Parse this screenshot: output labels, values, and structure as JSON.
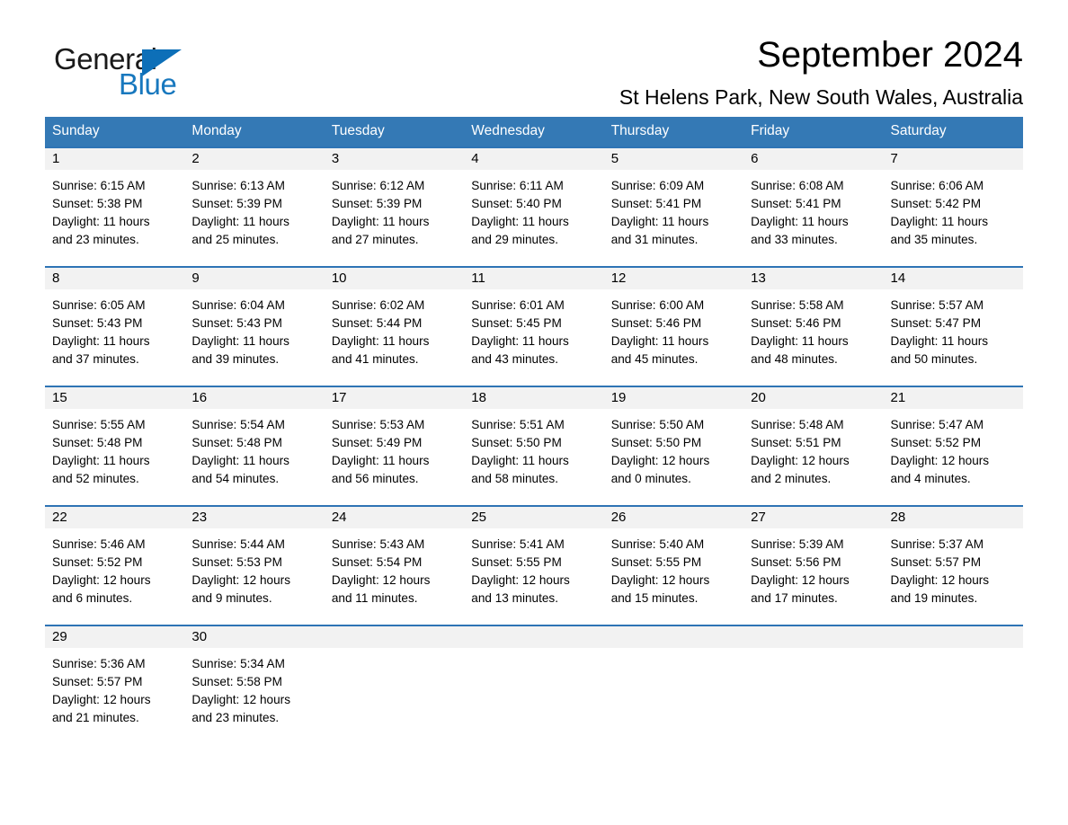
{
  "brand": {
    "name_part1": "General",
    "name_part2": "Blue",
    "triangle_icon": "brand-triangle-icon",
    "accent_color": "#1878be"
  },
  "header": {
    "month_title": "September 2024",
    "location": "St Helens Park, New South Wales, Australia"
  },
  "theme": {
    "header_blue": "#3479b5",
    "row_border_blue": "#2e74b5",
    "daynum_band": "#f2f2f2"
  },
  "calendar": {
    "weekday_headers": [
      "Sunday",
      "Monday",
      "Tuesday",
      "Wednesday",
      "Thursday",
      "Friday",
      "Saturday"
    ],
    "weeks": [
      [
        {
          "day": "1",
          "sunrise": "Sunrise: 6:15 AM",
          "sunset": "Sunset: 5:38 PM",
          "daylight_line1": "Daylight: 11 hours",
          "daylight_line2": "and 23 minutes."
        },
        {
          "day": "2",
          "sunrise": "Sunrise: 6:13 AM",
          "sunset": "Sunset: 5:39 PM",
          "daylight_line1": "Daylight: 11 hours",
          "daylight_line2": "and 25 minutes."
        },
        {
          "day": "3",
          "sunrise": "Sunrise: 6:12 AM",
          "sunset": "Sunset: 5:39 PM",
          "daylight_line1": "Daylight: 11 hours",
          "daylight_line2": "and 27 minutes."
        },
        {
          "day": "4",
          "sunrise": "Sunrise: 6:11 AM",
          "sunset": "Sunset: 5:40 PM",
          "daylight_line1": "Daylight: 11 hours",
          "daylight_line2": "and 29 minutes."
        },
        {
          "day": "5",
          "sunrise": "Sunrise: 6:09 AM",
          "sunset": "Sunset: 5:41 PM",
          "daylight_line1": "Daylight: 11 hours",
          "daylight_line2": "and 31 minutes."
        },
        {
          "day": "6",
          "sunrise": "Sunrise: 6:08 AM",
          "sunset": "Sunset: 5:41 PM",
          "daylight_line1": "Daylight: 11 hours",
          "daylight_line2": "and 33 minutes."
        },
        {
          "day": "7",
          "sunrise": "Sunrise: 6:06 AM",
          "sunset": "Sunset: 5:42 PM",
          "daylight_line1": "Daylight: 11 hours",
          "daylight_line2": "and 35 minutes."
        }
      ],
      [
        {
          "day": "8",
          "sunrise": "Sunrise: 6:05 AM",
          "sunset": "Sunset: 5:43 PM",
          "daylight_line1": "Daylight: 11 hours",
          "daylight_line2": "and 37 minutes."
        },
        {
          "day": "9",
          "sunrise": "Sunrise: 6:04 AM",
          "sunset": "Sunset: 5:43 PM",
          "daylight_line1": "Daylight: 11 hours",
          "daylight_line2": "and 39 minutes."
        },
        {
          "day": "10",
          "sunrise": "Sunrise: 6:02 AM",
          "sunset": "Sunset: 5:44 PM",
          "daylight_line1": "Daylight: 11 hours",
          "daylight_line2": "and 41 minutes."
        },
        {
          "day": "11",
          "sunrise": "Sunrise: 6:01 AM",
          "sunset": "Sunset: 5:45 PM",
          "daylight_line1": "Daylight: 11 hours",
          "daylight_line2": "and 43 minutes."
        },
        {
          "day": "12",
          "sunrise": "Sunrise: 6:00 AM",
          "sunset": "Sunset: 5:46 PM",
          "daylight_line1": "Daylight: 11 hours",
          "daylight_line2": "and 45 minutes."
        },
        {
          "day": "13",
          "sunrise": "Sunrise: 5:58 AM",
          "sunset": "Sunset: 5:46 PM",
          "daylight_line1": "Daylight: 11 hours",
          "daylight_line2": "and 48 minutes."
        },
        {
          "day": "14",
          "sunrise": "Sunrise: 5:57 AM",
          "sunset": "Sunset: 5:47 PM",
          "daylight_line1": "Daylight: 11 hours",
          "daylight_line2": "and 50 minutes."
        }
      ],
      [
        {
          "day": "15",
          "sunrise": "Sunrise: 5:55 AM",
          "sunset": "Sunset: 5:48 PM",
          "daylight_line1": "Daylight: 11 hours",
          "daylight_line2": "and 52 minutes."
        },
        {
          "day": "16",
          "sunrise": "Sunrise: 5:54 AM",
          "sunset": "Sunset: 5:48 PM",
          "daylight_line1": "Daylight: 11 hours",
          "daylight_line2": "and 54 minutes."
        },
        {
          "day": "17",
          "sunrise": "Sunrise: 5:53 AM",
          "sunset": "Sunset: 5:49 PM",
          "daylight_line1": "Daylight: 11 hours",
          "daylight_line2": "and 56 minutes."
        },
        {
          "day": "18",
          "sunrise": "Sunrise: 5:51 AM",
          "sunset": "Sunset: 5:50 PM",
          "daylight_line1": "Daylight: 11 hours",
          "daylight_line2": "and 58 minutes."
        },
        {
          "day": "19",
          "sunrise": "Sunrise: 5:50 AM",
          "sunset": "Sunset: 5:50 PM",
          "daylight_line1": "Daylight: 12 hours",
          "daylight_line2": "and 0 minutes."
        },
        {
          "day": "20",
          "sunrise": "Sunrise: 5:48 AM",
          "sunset": "Sunset: 5:51 PM",
          "daylight_line1": "Daylight: 12 hours",
          "daylight_line2": "and 2 minutes."
        },
        {
          "day": "21",
          "sunrise": "Sunrise: 5:47 AM",
          "sunset": "Sunset: 5:52 PM",
          "daylight_line1": "Daylight: 12 hours",
          "daylight_line2": "and 4 minutes."
        }
      ],
      [
        {
          "day": "22",
          "sunrise": "Sunrise: 5:46 AM",
          "sunset": "Sunset: 5:52 PM",
          "daylight_line1": "Daylight: 12 hours",
          "daylight_line2": "and 6 minutes."
        },
        {
          "day": "23",
          "sunrise": "Sunrise: 5:44 AM",
          "sunset": "Sunset: 5:53 PM",
          "daylight_line1": "Daylight: 12 hours",
          "daylight_line2": "and 9 minutes."
        },
        {
          "day": "24",
          "sunrise": "Sunrise: 5:43 AM",
          "sunset": "Sunset: 5:54 PM",
          "daylight_line1": "Daylight: 12 hours",
          "daylight_line2": "and 11 minutes."
        },
        {
          "day": "25",
          "sunrise": "Sunrise: 5:41 AM",
          "sunset": "Sunset: 5:55 PM",
          "daylight_line1": "Daylight: 12 hours",
          "daylight_line2": "and 13 minutes."
        },
        {
          "day": "26",
          "sunrise": "Sunrise: 5:40 AM",
          "sunset": "Sunset: 5:55 PM",
          "daylight_line1": "Daylight: 12 hours",
          "daylight_line2": "and 15 minutes."
        },
        {
          "day": "27",
          "sunrise": "Sunrise: 5:39 AM",
          "sunset": "Sunset: 5:56 PM",
          "daylight_line1": "Daylight: 12 hours",
          "daylight_line2": "and 17 minutes."
        },
        {
          "day": "28",
          "sunrise": "Sunrise: 5:37 AM",
          "sunset": "Sunset: 5:57 PM",
          "daylight_line1": "Daylight: 12 hours",
          "daylight_line2": "and 19 minutes."
        }
      ],
      [
        {
          "day": "29",
          "sunrise": "Sunrise: 5:36 AM",
          "sunset": "Sunset: 5:57 PM",
          "daylight_line1": "Daylight: 12 hours",
          "daylight_line2": "and 21 minutes."
        },
        {
          "day": "30",
          "sunrise": "Sunrise: 5:34 AM",
          "sunset": "Sunset: 5:58 PM",
          "daylight_line1": "Daylight: 12 hours",
          "daylight_line2": "and 23 minutes."
        },
        {
          "day": "",
          "sunrise": "",
          "sunset": "",
          "daylight_line1": "",
          "daylight_line2": ""
        },
        {
          "day": "",
          "sunrise": "",
          "sunset": "",
          "daylight_line1": "",
          "daylight_line2": ""
        },
        {
          "day": "",
          "sunrise": "",
          "sunset": "",
          "daylight_line1": "",
          "daylight_line2": ""
        },
        {
          "day": "",
          "sunrise": "",
          "sunset": "",
          "daylight_line1": "",
          "daylight_line2": ""
        },
        {
          "day": "",
          "sunrise": "",
          "sunset": "",
          "daylight_line1": "",
          "daylight_line2": ""
        }
      ]
    ]
  }
}
